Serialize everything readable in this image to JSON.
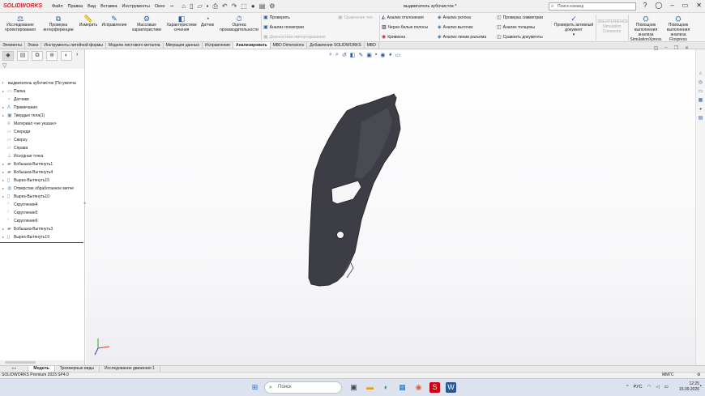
{
  "app": {
    "brand": "SOLIDWORKS",
    "doc_title": "выдвигатель зубочисток *"
  },
  "menu": [
    "Файл",
    "Правка",
    "Вид",
    "Вставка",
    "Инструменты",
    "Окно"
  ],
  "search": {
    "placeholder": "Поиск команд"
  },
  "ribbon": {
    "big": [
      {
        "label": "Исследование проектирования"
      },
      {
        "label": "Проверка интерференции"
      },
      {
        "label": "Измерить"
      },
      {
        "label": "Исправление"
      },
      {
        "label": "Массовые характеристики"
      },
      {
        "label": "Характеристики сечения"
      },
      {
        "label": "Датчик"
      },
      {
        "label": "Оценка производительности"
      }
    ],
    "col1": [
      {
        "label": "Проверить",
        "enabled": true
      },
      {
        "label": "Анализ геометрии",
        "enabled": true
      },
      {
        "label": "Диагностика импортирования",
        "enabled": false
      }
    ],
    "compare": "Сравнение тел",
    "col2": [
      "Анализ отклонения",
      "Черно-белые полосы",
      "Кривизна"
    ],
    "col3": [
      "Анализ уклона",
      "Анализ выточек",
      "Анализ линии разъема"
    ],
    "col4": [
      "Проверка симметрии",
      "Анализ толщины",
      "Сравнить документы"
    ],
    "active_doc": "Проверить активный документ",
    "disabled_big": "3DEXPERIENCE Simulation Connector",
    "right": [
      {
        "label": "Помощник выполнения анализа SimulationXpress"
      },
      {
        "label": "Помощник выполнения анализа Floxpress"
      }
    ]
  },
  "tabs": [
    {
      "label": "Элементы",
      "active": false
    },
    {
      "label": "Эскиз",
      "active": false
    },
    {
      "label": "Инструменты литейной формы",
      "active": false
    },
    {
      "label": "Модели листового металла",
      "active": false
    },
    {
      "label": "Миграция данных",
      "active": false
    },
    {
      "label": "Исправление",
      "active": false
    },
    {
      "label": "Анализировать",
      "active": true
    },
    {
      "label": "MBD Dimensions",
      "active": false
    },
    {
      "label": "Добавления SOLIDWORKS",
      "active": false
    },
    {
      "label": "MBD",
      "active": false
    }
  ],
  "tree": {
    "root": "выдвигатель зубочисток (По умолча",
    "items": [
      {
        "label": "Папка",
        "expandable": true,
        "icon": "folder-icon"
      },
      {
        "label": "Датчики",
        "expandable": false,
        "icon": "sensor-icon"
      },
      {
        "label": "Примечания",
        "expandable": true,
        "icon": "annotation-icon"
      },
      {
        "label": "Твердые тела(1)",
        "expandable": true,
        "icon": "solid-body-icon"
      },
      {
        "label": "Материал <не указан>",
        "expandable": false,
        "icon": "material-icon"
      },
      {
        "label": "Спереди",
        "expandable": false,
        "icon": "plane-icon"
      },
      {
        "label": "Сверху",
        "expandable": false,
        "icon": "plane-icon"
      },
      {
        "label": "Справа",
        "expandable": false,
        "icon": "plane-icon"
      },
      {
        "label": "Исходная точка",
        "expandable": false,
        "icon": "origin-icon"
      },
      {
        "label": "Бобышка-Вытянуть1",
        "expandable": true,
        "icon": "boss-extrude-icon"
      },
      {
        "label": "Бобышка-Вытянуть4",
        "expandable": true,
        "icon": "boss-extrude-icon"
      },
      {
        "label": "Вырез-Вытянуть15",
        "expandable": true,
        "icon": "cut-extrude-icon"
      },
      {
        "label": "Отверстие обработанное метче",
        "expandable": true,
        "icon": "hole-icon"
      },
      {
        "label": "Вырез-Вытянуть10",
        "expandable": true,
        "icon": "cut-extrude-icon"
      },
      {
        "label": "Скругление4",
        "expandable": false,
        "icon": "fillet-icon"
      },
      {
        "label": "Скругление5",
        "expandable": false,
        "icon": "fillet-icon"
      },
      {
        "label": "Скругление6",
        "expandable": false,
        "icon": "fillet-icon"
      },
      {
        "label": "Бобышка-Вытянуть3",
        "expandable": true,
        "icon": "boss-extrude-icon"
      },
      {
        "label": "Вырез-Вытянуть19",
        "expandable": true,
        "icon": "cut-extrude-icon"
      }
    ]
  },
  "model_tabs": [
    {
      "label": "Модель",
      "active": true
    },
    {
      "label": "Трехмерные виды",
      "active": false
    },
    {
      "label": "Исследование движения 1",
      "active": false
    }
  ],
  "status": {
    "left": "SOLIDWORKS Premium 2023 SP4.0",
    "units": "MMГС"
  },
  "taskbar": {
    "search_placeholder": "Поиск",
    "lang": "РУС",
    "time": "12:25",
    "date": "15.09.2026"
  },
  "colors": {
    "part": "#3d3d45",
    "brand": "#d71e28",
    "accent": "#2a5d9f"
  }
}
